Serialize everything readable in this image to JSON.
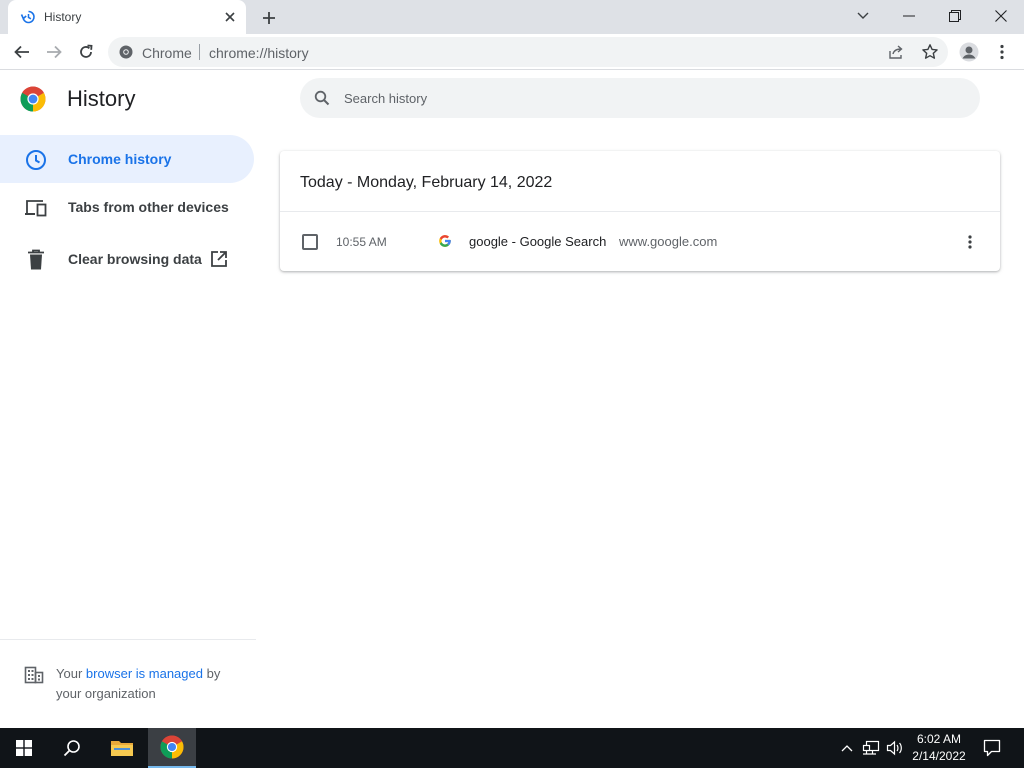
{
  "tab": {
    "title": "History"
  },
  "toolbar": {
    "omnibox_label": "Chrome",
    "url": "chrome://history"
  },
  "page": {
    "title": "History",
    "search_placeholder": "Search history"
  },
  "sidebar": {
    "items": [
      {
        "label": "Chrome history",
        "icon": "clock-icon",
        "active": true
      },
      {
        "label": "Tabs from other devices",
        "icon": "devices-icon",
        "active": false
      },
      {
        "label": "Clear browsing data",
        "icon": "trash-icon",
        "active": false
      }
    ],
    "managed_prefix": "Your",
    "managed_link": "browser is managed",
    "managed_suffix": "by your organization"
  },
  "history": {
    "date_heading": "Today - Monday, February 14, 2022",
    "entries": [
      {
        "time": "10:55 AM",
        "title": "google - Google Search",
        "domain": "www.google.com",
        "favicon": "google-g-icon"
      }
    ]
  },
  "taskbar": {
    "time": "6:02 AM",
    "date": "2/14/2022"
  },
  "colors": {
    "accent": "#1a73e8",
    "active_nav_bg": "#e8f0fe",
    "tabstrip_bg": "#dee1e6",
    "taskbar_bg": "#101418"
  }
}
